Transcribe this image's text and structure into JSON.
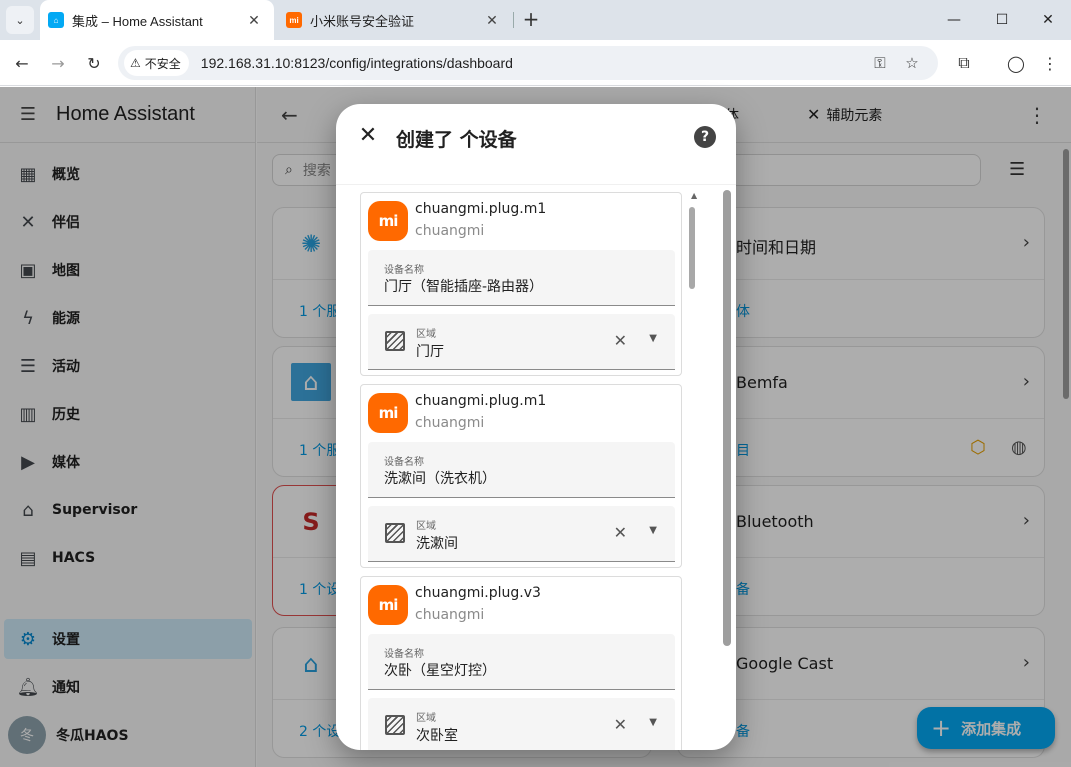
{
  "browser": {
    "tabs": [
      {
        "title": "集成 – Home Assistant",
        "favicon_color": "#03a9f4"
      },
      {
        "title": "小米账号安全验证",
        "favicon_color": "#ff6900",
        "favicon_text": "mi"
      }
    ],
    "insecure_label": "不安全",
    "url": "192.168.31.10:8123/config/integrations/dashboard"
  },
  "sidebar": {
    "title": "Home Assistant",
    "items": [
      {
        "label": "概览",
        "icon": "dashboard-icon"
      },
      {
        "label": "伴侣",
        "icon": "tools-icon"
      },
      {
        "label": "地图",
        "icon": "map-icon"
      },
      {
        "label": "能源",
        "icon": "lightning-icon"
      },
      {
        "label": "活动",
        "icon": "list-icon"
      },
      {
        "label": "历史",
        "icon": "chart-icon"
      },
      {
        "label": "媒体",
        "icon": "play-icon"
      },
      {
        "label": "Supervisor",
        "icon": "supervisor-icon"
      },
      {
        "label": "HACS",
        "icon": "hacs-icon"
      },
      {
        "label": "设置",
        "icon": "gear-icon"
      },
      {
        "label": "通知",
        "icon": "bell-icon"
      }
    ],
    "user": {
      "avatar": "冬",
      "name": "冬瓜HAOS"
    }
  },
  "main": {
    "header_tabs": {
      "partial": "体",
      "helpers": "辅助元素"
    },
    "search_placeholder": "搜索",
    "cards_left": [
      {
        "link": "1 个服"
      },
      {
        "link": "1 个服"
      },
      {
        "link": "1 个设"
      },
      {
        "link": "2 个设"
      }
    ],
    "cards_right": [
      {
        "name": "时间和日期",
        "link": "体"
      },
      {
        "name": "Bemfa",
        "link": "目"
      },
      {
        "name": "Bluetooth",
        "link": "备"
      },
      {
        "name": "Google Cast",
        "link": "备"
      }
    ],
    "fab_label": "添加集成"
  },
  "dialog": {
    "title": "创建了 个设备",
    "name_label": "设备名称",
    "area_label": "区域",
    "devices": [
      {
        "model": "chuangmi.plug.m1",
        "maker": "chuangmi",
        "name": "门厅（智能插座-路由器）",
        "area": "门厅"
      },
      {
        "model": "chuangmi.plug.m1",
        "maker": "chuangmi",
        "name": "洗漱间（洗衣机）",
        "area": "洗漱间"
      },
      {
        "model": "chuangmi.plug.v3",
        "maker": "chuangmi",
        "name": "次卧（星空灯控）",
        "area": "次卧室"
      }
    ],
    "logo_text": "mi"
  },
  "colors": {
    "accent": "#03a9f4",
    "xiaomi": "#ff6900",
    "sidebar_selected": "#0288d1"
  }
}
